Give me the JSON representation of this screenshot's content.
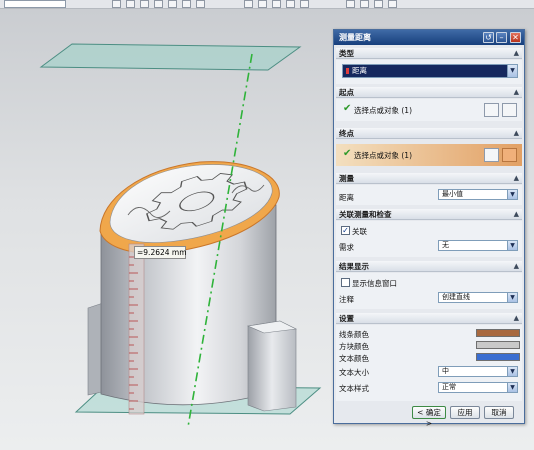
{
  "viewport": {
    "measure_value": "=9.2624 mm"
  },
  "dialog": {
    "title": "测量距离",
    "sections": {
      "type": {
        "header": "类型",
        "value": "距离"
      },
      "start_point": {
        "header": "起点",
        "select_text": "选择点或对象 (1)"
      },
      "end_point": {
        "header": "终点",
        "select_text": "选择点或对象 (1)"
      },
      "measure": {
        "header": "测量",
        "distance_label": "距离",
        "distance_value": "最小值"
      },
      "associative": {
        "header": "关联测量和检查",
        "checkbox_label": "关联",
        "requirement_label": "需求",
        "requirement_value": "无"
      },
      "results": {
        "header": "结果显示",
        "checkbox_label": "显示信息窗口",
        "annotation_label": "注释",
        "annotation_value": "创建直线"
      },
      "settings": {
        "header": "设置",
        "line_color_label": "线条颜色",
        "block_color_label": "方块颜色",
        "text_color_label": "文本颜色",
        "text_size_label": "文本大小",
        "text_size_value": "中",
        "text_style_label": "文本样式",
        "text_style_value": "正常"
      }
    },
    "buttons": {
      "ok": "< 确定 >",
      "apply": "应用",
      "cancel": "取消"
    },
    "colors": {
      "line": "#a8693f",
      "block": "#c9c9c9",
      "text": "#3a6ed1"
    }
  }
}
